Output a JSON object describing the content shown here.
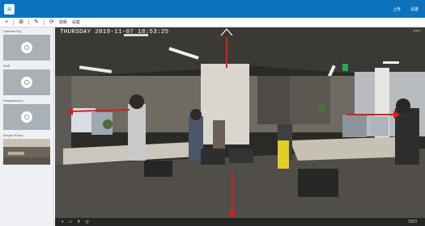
{
  "titlebar": {
    "logo": "≡",
    "actions": [
      "上传",
      "设置"
    ]
  },
  "toolbar": {
    "items": [
      {
        "icon": "plus-icon",
        "glyph": "+"
      },
      {
        "icon": "grid-icon",
        "glyph": "⊞"
      },
      {
        "icon": "edit-icon",
        "glyph": "✎"
      },
      {
        "icon": "refresh-icon",
        "glyph": "⟳"
      }
    ],
    "labels": [
      "视频",
      "设置"
    ]
  },
  "sidebar": {
    "cameras": [
      {
        "label": "Camera-01p",
        "live": false
      },
      {
        "label": "NVR",
        "live": false
      },
      {
        "label": "Integrated-ipc",
        "live": false
      },
      {
        "label": "Integer-Room",
        "live": true
      }
    ]
  },
  "video": {
    "timestamp": "THURSDAY 2019-11-07 18:53:25",
    "close_label": "×××",
    "controls": [
      "⏸",
      "▭",
      "⬆",
      "◎"
    ],
    "right_label": "1920"
  },
  "colors": {
    "titlebar": "#0d72bd",
    "ptz_arrow": "#d61f1f"
  }
}
